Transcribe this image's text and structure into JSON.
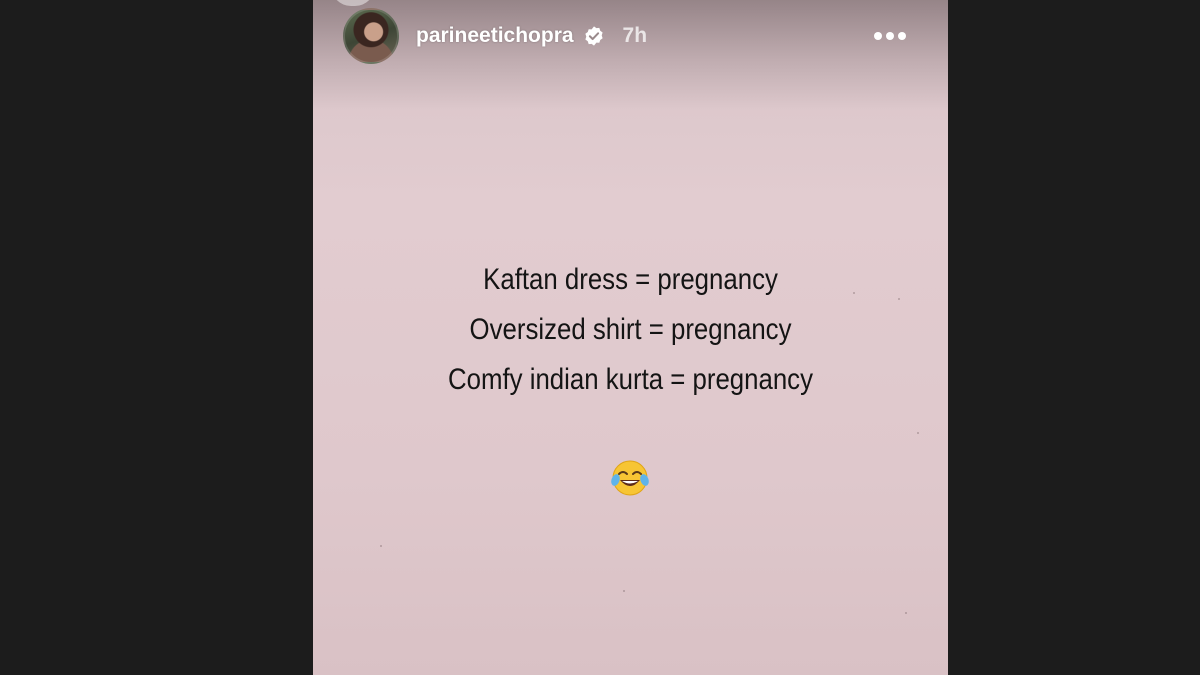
{
  "story": {
    "author": {
      "username": "parineetichopra",
      "verified": true,
      "verified_icon": "verified-badge-icon",
      "avatar_icon": "profile-avatar"
    },
    "posted_ago": "7h",
    "menu_icon": "more-options-icon",
    "caption_lines": [
      "Kaftan dress = pregnancy",
      "Oversized shirt = pregnancy",
      "Comfy indian kurta = pregnancy"
    ],
    "emoji": "😂",
    "emoji_icon": "tears-of-joy-emoji",
    "colors": {
      "background": "#1c1c1c",
      "story_background": "#e0cace",
      "text": "#141414",
      "header_text": "#ffffff"
    }
  }
}
